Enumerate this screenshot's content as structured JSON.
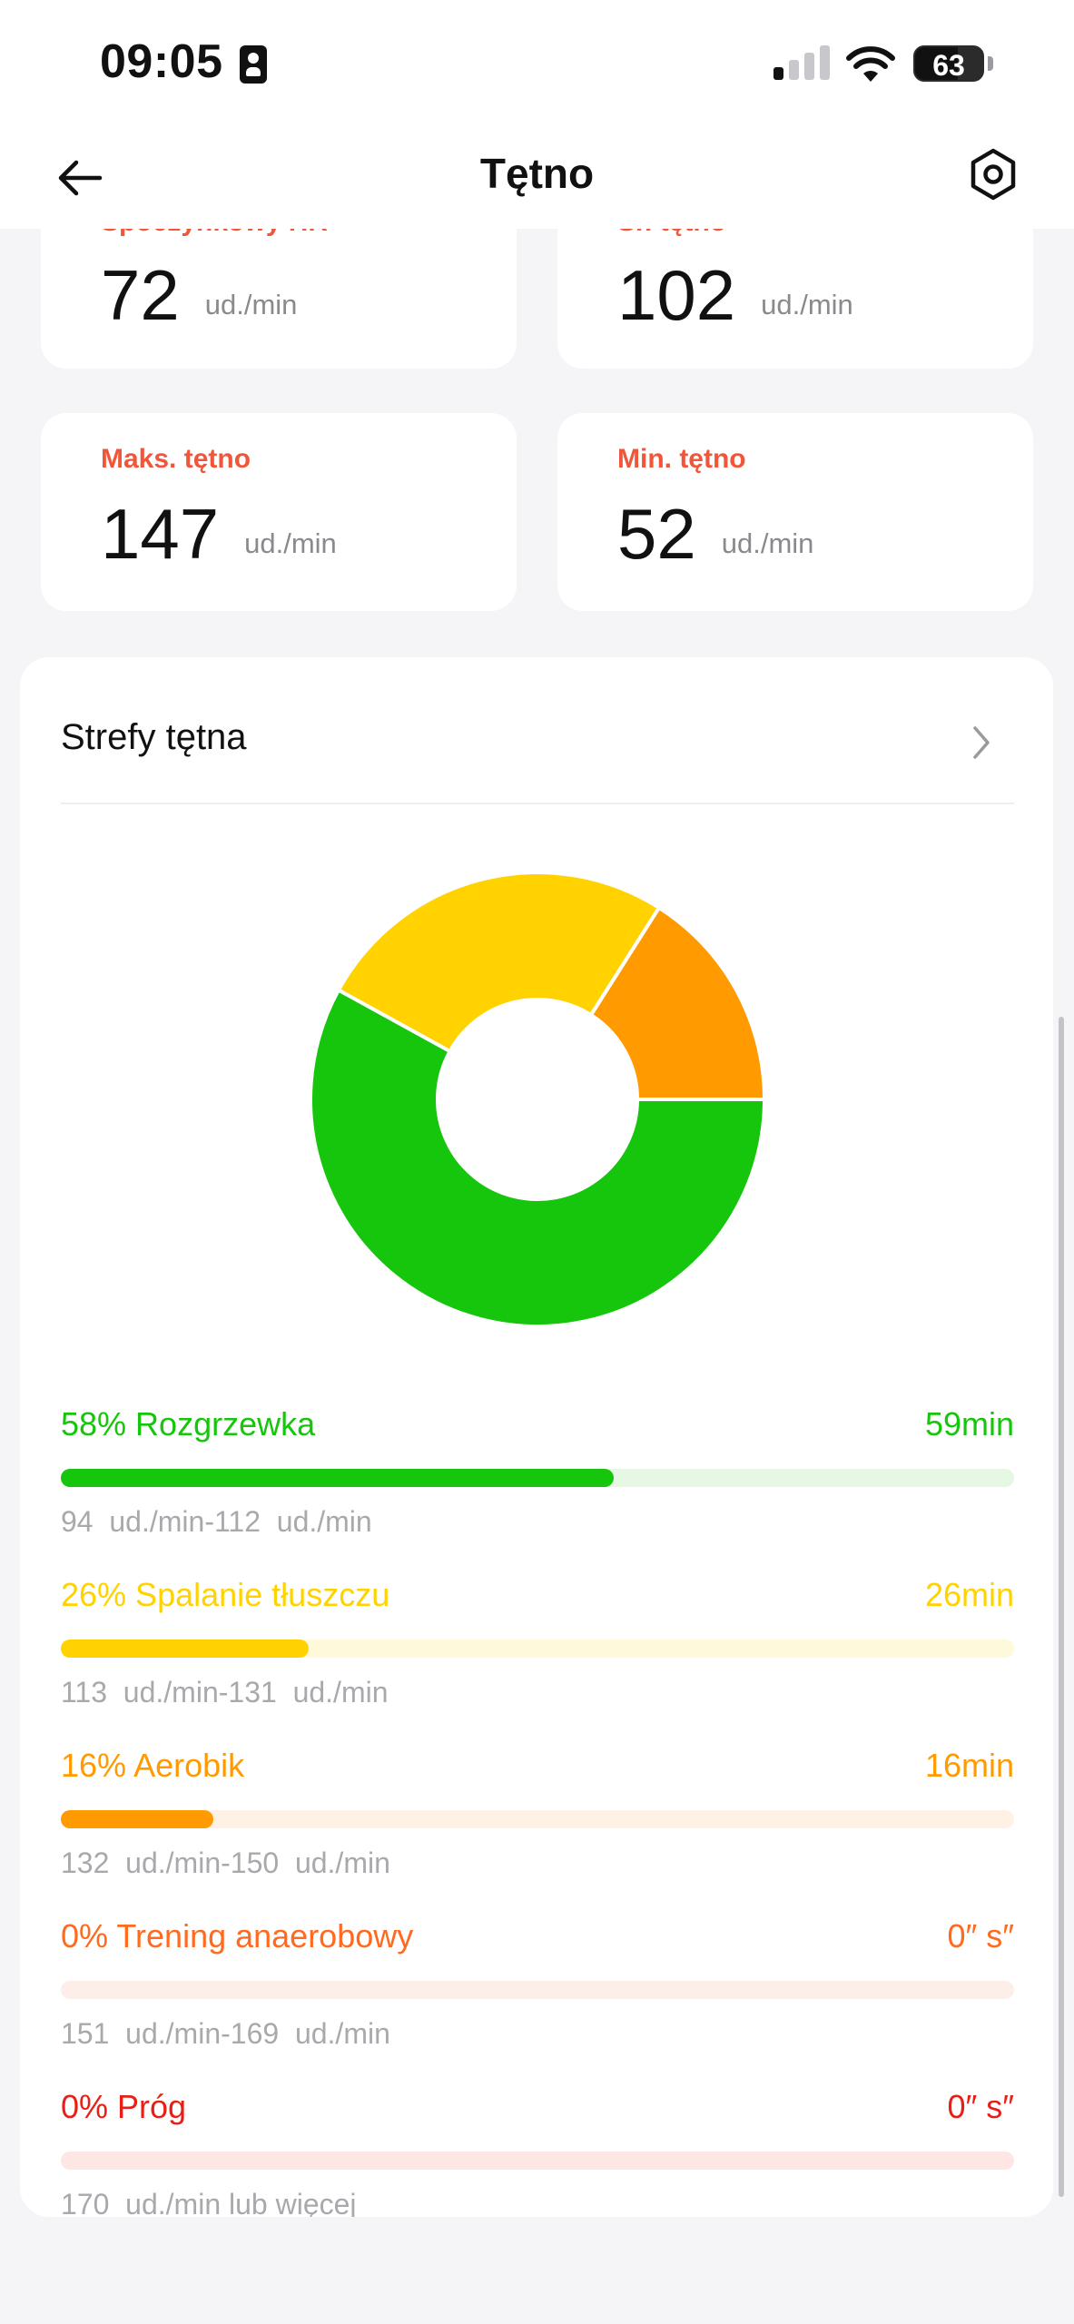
{
  "status_bar": {
    "time": "09:05",
    "battery": "63"
  },
  "header": {
    "title": "Tętno"
  },
  "stats": {
    "resting": {
      "label": "Spoczynkowy HR",
      "value": "72",
      "unit": "ud./min"
    },
    "average": {
      "label": "Śr. tętno",
      "value": "102",
      "unit": "ud./min"
    },
    "max": {
      "label": "Maks. tętno",
      "value": "147",
      "unit": "ud./min"
    },
    "min": {
      "label": "Min. tętno",
      "value": "52",
      "unit": "ud./min"
    }
  },
  "zones": {
    "title": "Strefy tętna",
    "items": [
      {
        "name": "58% Rozgrzewka",
        "time": "59min",
        "range": "94  ud./min-112  ud./min",
        "percent": 58,
        "color": "#16c60c",
        "track": "#e6f8e4"
      },
      {
        "name": "26% Spalanie tłuszczu",
        "time": "26min",
        "range": "113  ud./min-131  ud./min",
        "percent": 26,
        "color": "#ffd200",
        "track": "#fff9dc"
      },
      {
        "name": "16% Aerobik",
        "time": "16min",
        "range": "132  ud./min-150  ud./min",
        "percent": 16,
        "color": "#ff9a00",
        "track": "#fff1e3"
      },
      {
        "name": "0% Trening anaerobowy",
        "time": "0″ s″",
        "range": "151  ud./min-169  ud./min",
        "percent": 0,
        "color": "#ff6a1f",
        "track": "#fdeee9"
      },
      {
        "name": "0% Próg",
        "time": "0″ s″",
        "range": "170  ud./min lub więcej",
        "percent": 0,
        "color": "#e81f17",
        "track": "#fde6e4"
      }
    ]
  },
  "chart_data": {
    "type": "pie",
    "categories": [
      "Rozgrzewka",
      "Spalanie tłuszczu",
      "Aerobik",
      "Trening anaerobowy",
      "Próg"
    ],
    "values": [
      58,
      26,
      16,
      0,
      0
    ],
    "colors": [
      "#16c60c",
      "#ffd200",
      "#ff9a00",
      "#ff6a1f",
      "#e81f17"
    ]
  },
  "icons": {
    "back": "back-arrow-icon",
    "settings": "settings-hexagon-icon",
    "chevron": "chevron-right-icon"
  }
}
